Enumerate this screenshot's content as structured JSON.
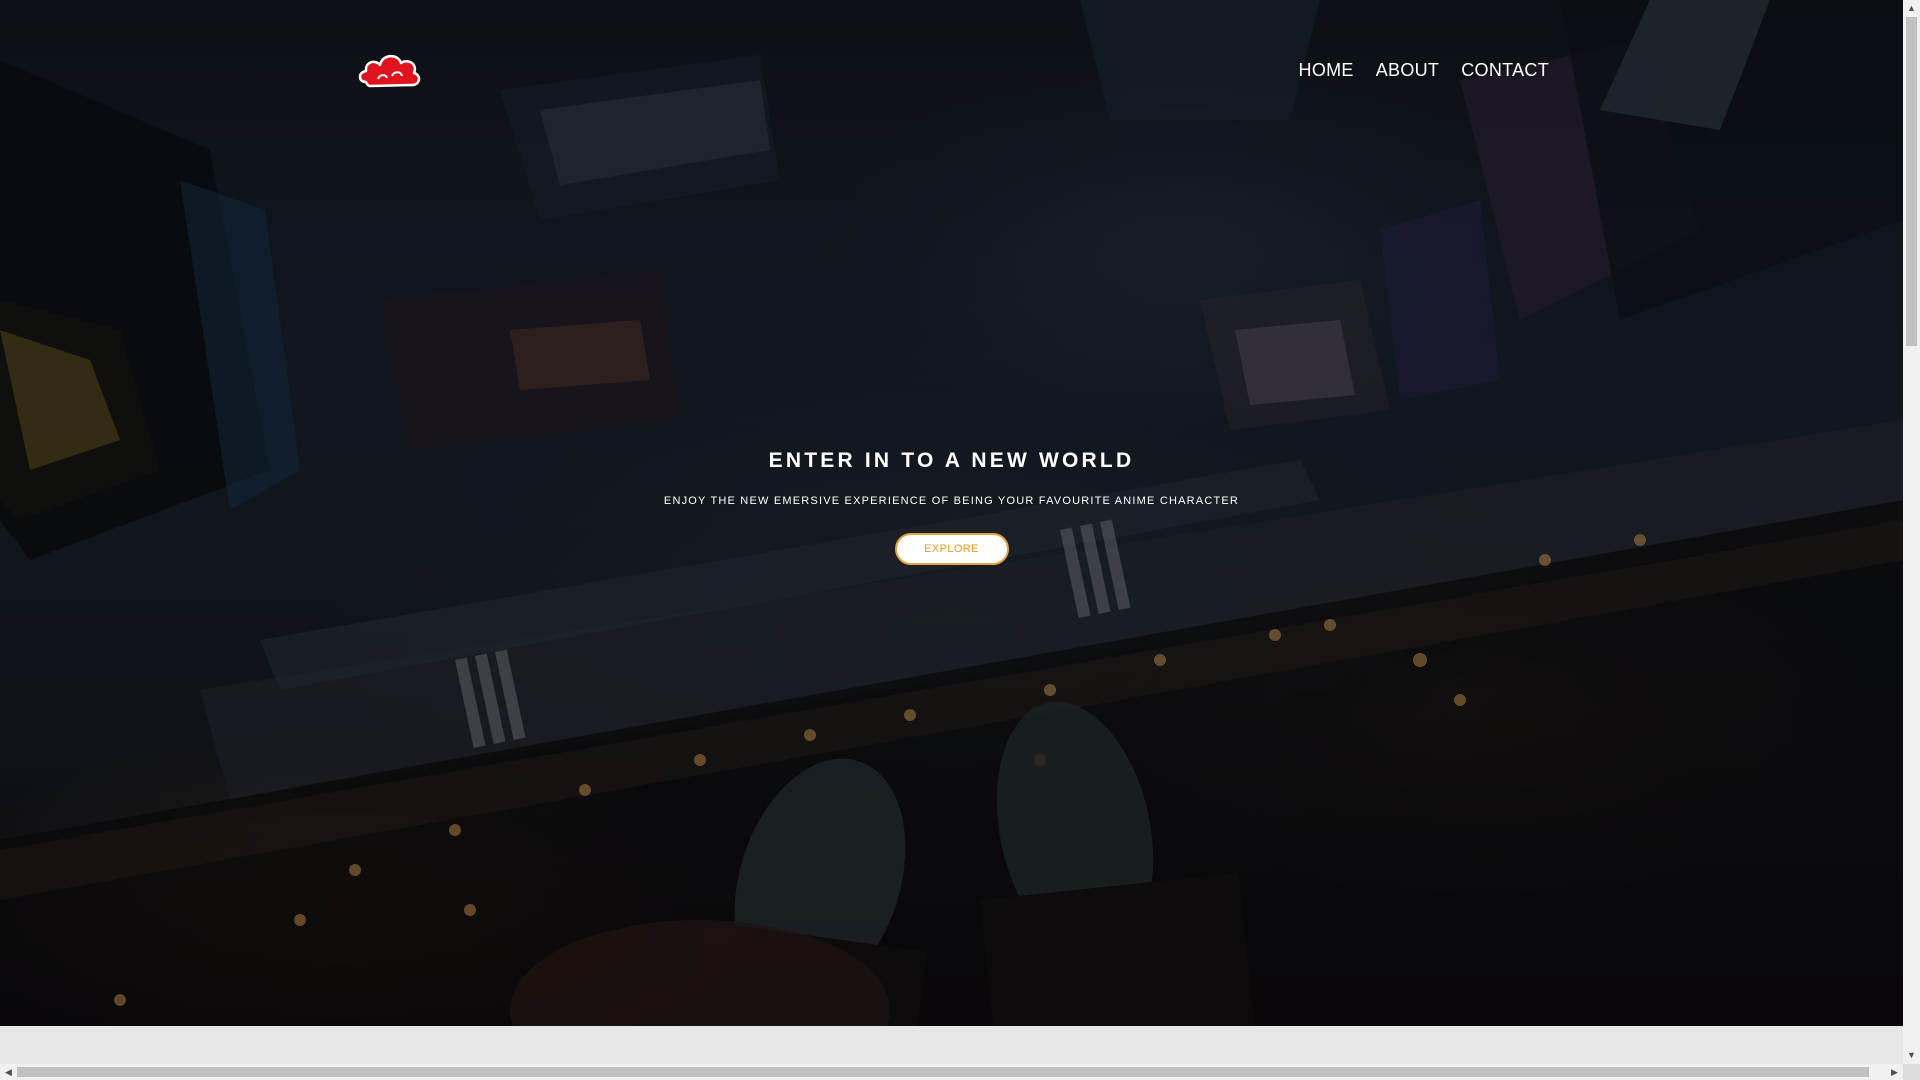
{
  "nav": {
    "logo_icon": "red-cloud-icon",
    "items": [
      {
        "label": "HOME"
      },
      {
        "label": "ABOUT"
      },
      {
        "label": "CONTACT"
      }
    ]
  },
  "hero": {
    "title": "ENTER IN TO A NEW WORLD",
    "subtitle": "ENJOY THE NEW EMERSIVE EXPERIENCE OF BEING YOUR FAVOURITE ANIME CHARACTER",
    "cta_label": "EXPLORE",
    "background": "night city viewed from rooftop with dangling feet"
  },
  "colors": {
    "cta_text": "#e79a26",
    "cta_border": "#e6a23a",
    "logo_red": "#e0141e",
    "nav_text": "#ffffff"
  }
}
